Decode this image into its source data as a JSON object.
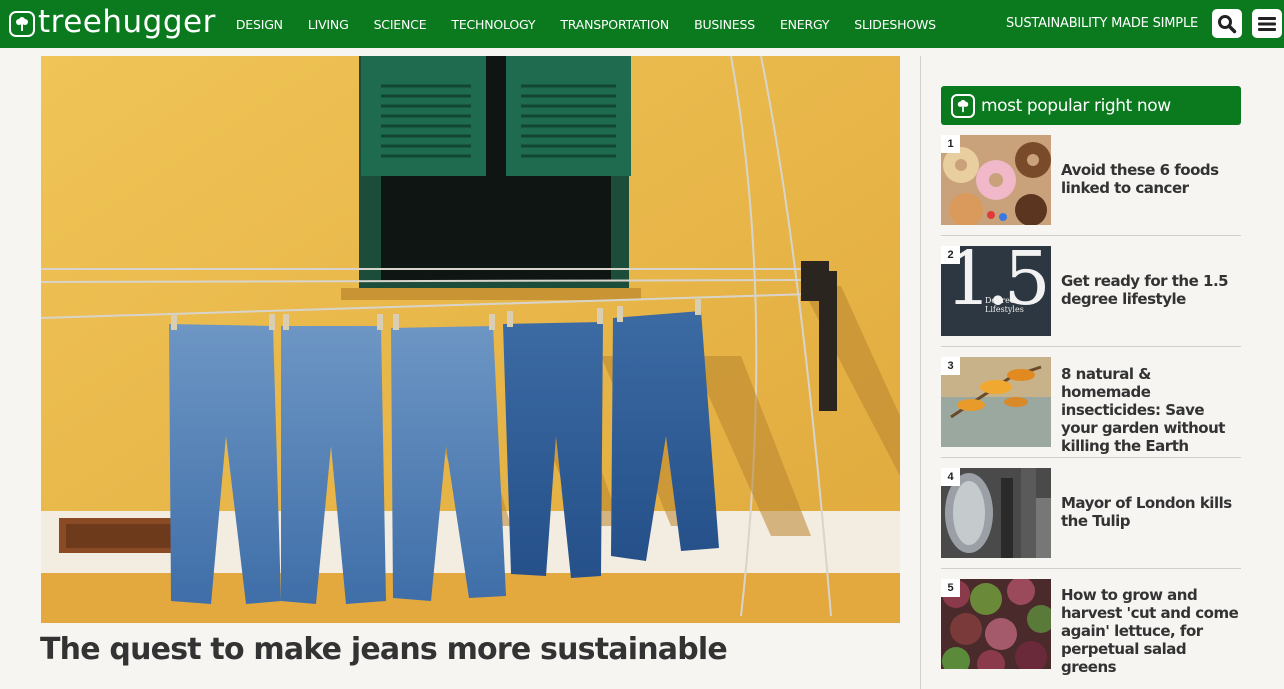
{
  "header": {
    "logo_text": "treehugger",
    "nav": [
      "DESIGN",
      "LIVING",
      "SCIENCE",
      "TECHNOLOGY",
      "TRANSPORTATION",
      "BUSINESS",
      "ENERGY",
      "SLIDESHOWS"
    ],
    "tagline": "SUSTAINABILITY MADE SIMPLE",
    "search_icon": "search-icon",
    "menu_icon": "hamburger-menu-icon"
  },
  "hero": {
    "headline": "The quest to make jeans more sustainable"
  },
  "sidebar": {
    "title": "most popular right now",
    "items": [
      {
        "rank": "1",
        "title": "Avoid these 6 foods linked to cancer"
      },
      {
        "rank": "2",
        "title": "Get ready for the 1.5 degree lifestyle",
        "thumb_text": "1.5",
        "thumb_caption": "Degree Lifestyles"
      },
      {
        "rank": "3",
        "title": "8 natural & homemade insecticides: Save your garden without killing the Earth"
      },
      {
        "rank": "4",
        "title": "Mayor of London kills the Tulip"
      },
      {
        "rank": "5",
        "title": "How to grow and harvest 'cut and come again' lettuce, for perpetual salad greens"
      }
    ]
  },
  "colors": {
    "brand_green": "#0b7a1f",
    "background": "#f6f5f2",
    "text": "#333333"
  }
}
